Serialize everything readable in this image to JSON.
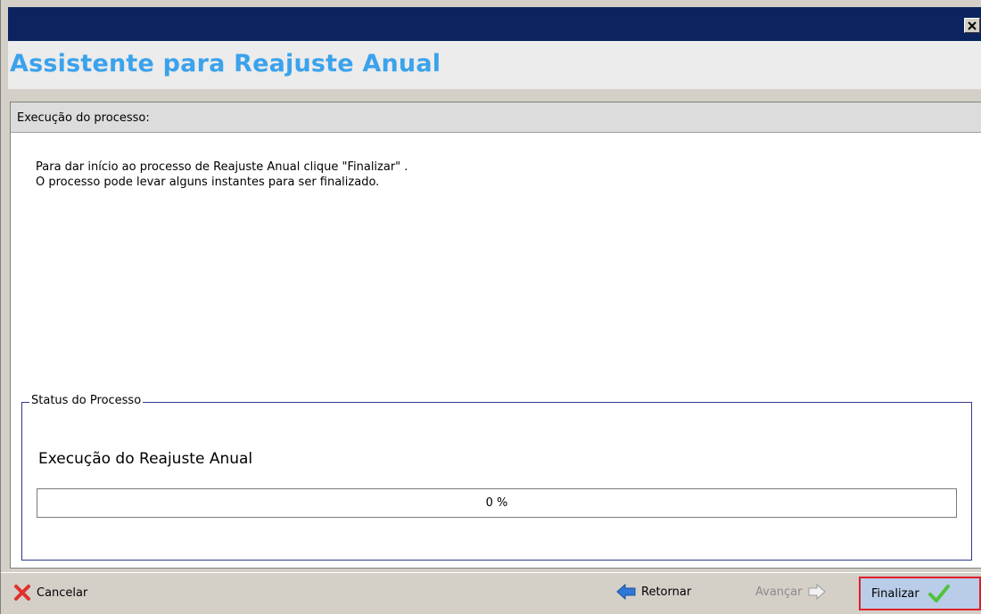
{
  "window": {
    "close_symbol": "✕",
    "title": "Assistente para Reajuste Anual",
    "title_color": "#3ba2ec",
    "titlebar_color": "#0b2460"
  },
  "section": {
    "label": "Execução do processo:"
  },
  "description": {
    "line1": "Para dar início ao processo de Reajuste Anual clique \"Finalizar\" .",
    "line2": "O processo pode levar alguns instantes para ser finalizado."
  },
  "status_group": {
    "legend": "Status do Processo",
    "process_label": "Execução do Reajuste Anual",
    "progress_value": 0,
    "progress_text": "0 %"
  },
  "footer": {
    "cancel_label": "Cancelar",
    "cancel_icon": "red-x-icon",
    "back_label": "Retornar",
    "back_icon": "blue-left-arrow-icon",
    "next_label": "Avançar",
    "next_icon": "gray-right-arrow-icon",
    "finish_label": "Finalizar",
    "finish_icon": "green-check-icon",
    "finish_highlight_color": "#e0202a"
  }
}
